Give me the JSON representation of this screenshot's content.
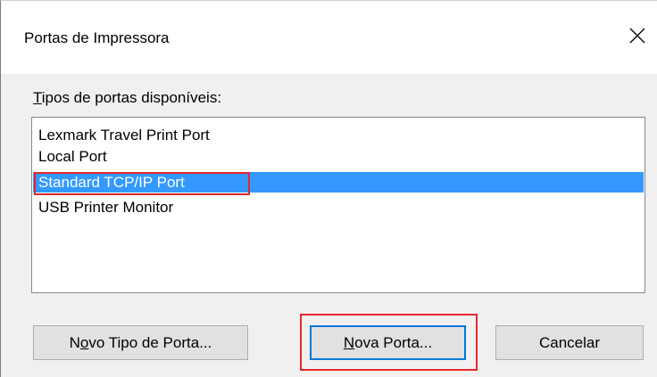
{
  "window": {
    "title": "Portas de Impressora",
    "close_icon": "close-icon"
  },
  "group": {
    "label_accel": "T",
    "label_rest": "ipos de portas disponíveis:"
  },
  "port_types": [
    {
      "label": "Lexmark Travel Print Port",
      "selected": false
    },
    {
      "label": "Local Port",
      "selected": false
    },
    {
      "label": "Standard TCP/IP Port",
      "selected": true
    },
    {
      "label": "USB Printer Monitor",
      "selected": false
    }
  ],
  "buttons": {
    "new_port_type": {
      "pre": "N",
      "accel": "o",
      "post": "vo Tipo de Porta..."
    },
    "new_port": {
      "pre": "",
      "accel": "N",
      "post": "ova Porta..."
    },
    "cancel": {
      "label": "Cancelar"
    }
  },
  "colors": {
    "selection": "#3399ff",
    "annotation_red": "#e8262d",
    "default_button_border": "#0078d7"
  }
}
